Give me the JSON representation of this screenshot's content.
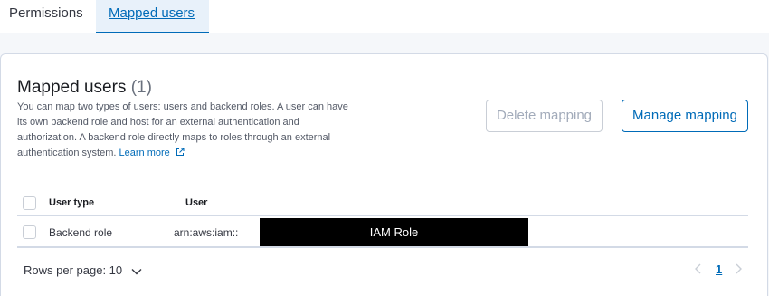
{
  "tabs": [
    {
      "label": "Permissions",
      "active": false
    },
    {
      "label": "Mapped users",
      "active": true
    }
  ],
  "section": {
    "title": "Mapped users",
    "count": "(1)",
    "description": "You can map two types of users: users and backend roles. A user can have its own backend role and host for an external authentication and authorization. A backend role directly maps to roles through an external authentication system.",
    "learn_more": "Learn more"
  },
  "buttons": {
    "delete": "Delete mapping",
    "manage": "Manage mapping"
  },
  "table": {
    "columns": [
      "User type",
      "User"
    ],
    "rows": [
      {
        "user_type": "Backend role",
        "user_prefix": "arn:aws:iam::",
        "redacted_label": "IAM Role"
      }
    ]
  },
  "pagination": {
    "rows_per_page_label": "Rows per page: 10",
    "current_page": "1"
  },
  "colors": {
    "accent": "#006bb8",
    "border": "#d3dae6",
    "disabled_text": "#a2abba"
  }
}
